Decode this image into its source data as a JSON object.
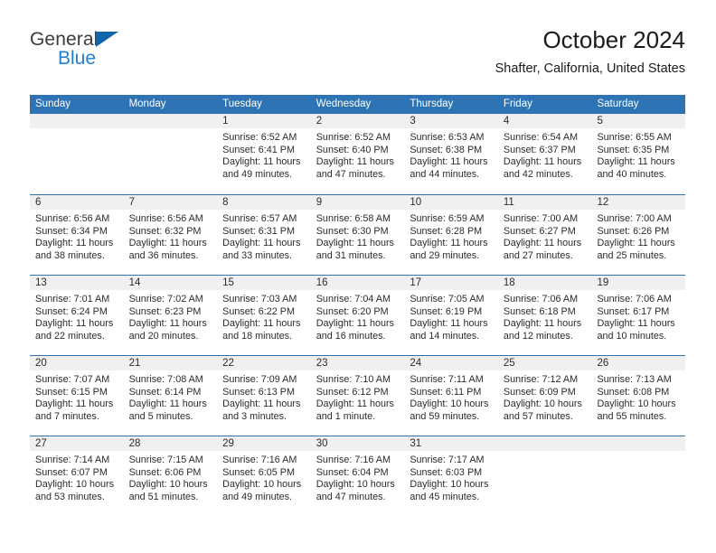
{
  "brand": {
    "name_part1": "General",
    "name_part2": "Blue",
    "logo_icon": "triangle-logo-icon",
    "accent_dark": "#1464aa",
    "accent_light": "#1f7fd0"
  },
  "header": {
    "title": "October 2024",
    "subtitle": "Shafter, California, United States"
  },
  "theme": {
    "header_blue": "#2e74b5",
    "day_band_gray": "#f0f0f0",
    "text": "#2b2b2b"
  },
  "weekdays": [
    "Sunday",
    "Monday",
    "Tuesday",
    "Wednesday",
    "Thursday",
    "Friday",
    "Saturday"
  ],
  "weeks": [
    [
      {
        "day": "",
        "sunrise": "",
        "sunset": "",
        "daylight_line1": "",
        "daylight_line2": ""
      },
      {
        "day": "",
        "sunrise": "",
        "sunset": "",
        "daylight_line1": "",
        "daylight_line2": ""
      },
      {
        "day": "1",
        "sunrise": "Sunrise: 6:52 AM",
        "sunset": "Sunset: 6:41 PM",
        "daylight_line1": "Daylight: 11 hours",
        "daylight_line2": "and 49 minutes."
      },
      {
        "day": "2",
        "sunrise": "Sunrise: 6:52 AM",
        "sunset": "Sunset: 6:40 PM",
        "daylight_line1": "Daylight: 11 hours",
        "daylight_line2": "and 47 minutes."
      },
      {
        "day": "3",
        "sunrise": "Sunrise: 6:53 AM",
        "sunset": "Sunset: 6:38 PM",
        "daylight_line1": "Daylight: 11 hours",
        "daylight_line2": "and 44 minutes."
      },
      {
        "day": "4",
        "sunrise": "Sunrise: 6:54 AM",
        "sunset": "Sunset: 6:37 PM",
        "daylight_line1": "Daylight: 11 hours",
        "daylight_line2": "and 42 minutes."
      },
      {
        "day": "5",
        "sunrise": "Sunrise: 6:55 AM",
        "sunset": "Sunset: 6:35 PM",
        "daylight_line1": "Daylight: 11 hours",
        "daylight_line2": "and 40 minutes."
      }
    ],
    [
      {
        "day": "6",
        "sunrise": "Sunrise: 6:56 AM",
        "sunset": "Sunset: 6:34 PM",
        "daylight_line1": "Daylight: 11 hours",
        "daylight_line2": "and 38 minutes."
      },
      {
        "day": "7",
        "sunrise": "Sunrise: 6:56 AM",
        "sunset": "Sunset: 6:32 PM",
        "daylight_line1": "Daylight: 11 hours",
        "daylight_line2": "and 36 minutes."
      },
      {
        "day": "8",
        "sunrise": "Sunrise: 6:57 AM",
        "sunset": "Sunset: 6:31 PM",
        "daylight_line1": "Daylight: 11 hours",
        "daylight_line2": "and 33 minutes."
      },
      {
        "day": "9",
        "sunrise": "Sunrise: 6:58 AM",
        "sunset": "Sunset: 6:30 PM",
        "daylight_line1": "Daylight: 11 hours",
        "daylight_line2": "and 31 minutes."
      },
      {
        "day": "10",
        "sunrise": "Sunrise: 6:59 AM",
        "sunset": "Sunset: 6:28 PM",
        "daylight_line1": "Daylight: 11 hours",
        "daylight_line2": "and 29 minutes."
      },
      {
        "day": "11",
        "sunrise": "Sunrise: 7:00 AM",
        "sunset": "Sunset: 6:27 PM",
        "daylight_line1": "Daylight: 11 hours",
        "daylight_line2": "and 27 minutes."
      },
      {
        "day": "12",
        "sunrise": "Sunrise: 7:00 AM",
        "sunset": "Sunset: 6:26 PM",
        "daylight_line1": "Daylight: 11 hours",
        "daylight_line2": "and 25 minutes."
      }
    ],
    [
      {
        "day": "13",
        "sunrise": "Sunrise: 7:01 AM",
        "sunset": "Sunset: 6:24 PM",
        "daylight_line1": "Daylight: 11 hours",
        "daylight_line2": "and 22 minutes."
      },
      {
        "day": "14",
        "sunrise": "Sunrise: 7:02 AM",
        "sunset": "Sunset: 6:23 PM",
        "daylight_line1": "Daylight: 11 hours",
        "daylight_line2": "and 20 minutes."
      },
      {
        "day": "15",
        "sunrise": "Sunrise: 7:03 AM",
        "sunset": "Sunset: 6:22 PM",
        "daylight_line1": "Daylight: 11 hours",
        "daylight_line2": "and 18 minutes."
      },
      {
        "day": "16",
        "sunrise": "Sunrise: 7:04 AM",
        "sunset": "Sunset: 6:20 PM",
        "daylight_line1": "Daylight: 11 hours",
        "daylight_line2": "and 16 minutes."
      },
      {
        "day": "17",
        "sunrise": "Sunrise: 7:05 AM",
        "sunset": "Sunset: 6:19 PM",
        "daylight_line1": "Daylight: 11 hours",
        "daylight_line2": "and 14 minutes."
      },
      {
        "day": "18",
        "sunrise": "Sunrise: 7:06 AM",
        "sunset": "Sunset: 6:18 PM",
        "daylight_line1": "Daylight: 11 hours",
        "daylight_line2": "and 12 minutes."
      },
      {
        "day": "19",
        "sunrise": "Sunrise: 7:06 AM",
        "sunset": "Sunset: 6:17 PM",
        "daylight_line1": "Daylight: 11 hours",
        "daylight_line2": "and 10 minutes."
      }
    ],
    [
      {
        "day": "20",
        "sunrise": "Sunrise: 7:07 AM",
        "sunset": "Sunset: 6:15 PM",
        "daylight_line1": "Daylight: 11 hours",
        "daylight_line2": "and 7 minutes."
      },
      {
        "day": "21",
        "sunrise": "Sunrise: 7:08 AM",
        "sunset": "Sunset: 6:14 PM",
        "daylight_line1": "Daylight: 11 hours",
        "daylight_line2": "and 5 minutes."
      },
      {
        "day": "22",
        "sunrise": "Sunrise: 7:09 AM",
        "sunset": "Sunset: 6:13 PM",
        "daylight_line1": "Daylight: 11 hours",
        "daylight_line2": "and 3 minutes."
      },
      {
        "day": "23",
        "sunrise": "Sunrise: 7:10 AM",
        "sunset": "Sunset: 6:12 PM",
        "daylight_line1": "Daylight: 11 hours",
        "daylight_line2": "and 1 minute."
      },
      {
        "day": "24",
        "sunrise": "Sunrise: 7:11 AM",
        "sunset": "Sunset: 6:11 PM",
        "daylight_line1": "Daylight: 10 hours",
        "daylight_line2": "and 59 minutes."
      },
      {
        "day": "25",
        "sunrise": "Sunrise: 7:12 AM",
        "sunset": "Sunset: 6:09 PM",
        "daylight_line1": "Daylight: 10 hours",
        "daylight_line2": "and 57 minutes."
      },
      {
        "day": "26",
        "sunrise": "Sunrise: 7:13 AM",
        "sunset": "Sunset: 6:08 PM",
        "daylight_line1": "Daylight: 10 hours",
        "daylight_line2": "and 55 minutes."
      }
    ],
    [
      {
        "day": "27",
        "sunrise": "Sunrise: 7:14 AM",
        "sunset": "Sunset: 6:07 PM",
        "daylight_line1": "Daylight: 10 hours",
        "daylight_line2": "and 53 minutes."
      },
      {
        "day": "28",
        "sunrise": "Sunrise: 7:15 AM",
        "sunset": "Sunset: 6:06 PM",
        "daylight_line1": "Daylight: 10 hours",
        "daylight_line2": "and 51 minutes."
      },
      {
        "day": "29",
        "sunrise": "Sunrise: 7:16 AM",
        "sunset": "Sunset: 6:05 PM",
        "daylight_line1": "Daylight: 10 hours",
        "daylight_line2": "and 49 minutes."
      },
      {
        "day": "30",
        "sunrise": "Sunrise: 7:16 AM",
        "sunset": "Sunset: 6:04 PM",
        "daylight_line1": "Daylight: 10 hours",
        "daylight_line2": "and 47 minutes."
      },
      {
        "day": "31",
        "sunrise": "Sunrise: 7:17 AM",
        "sunset": "Sunset: 6:03 PM",
        "daylight_line1": "Daylight: 10 hours",
        "daylight_line2": "and 45 minutes."
      },
      {
        "day": "",
        "sunrise": "",
        "sunset": "",
        "daylight_line1": "",
        "daylight_line2": ""
      },
      {
        "day": "",
        "sunrise": "",
        "sunset": "",
        "daylight_line1": "",
        "daylight_line2": ""
      }
    ]
  ]
}
